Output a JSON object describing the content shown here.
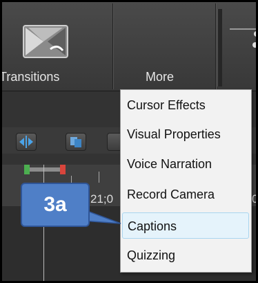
{
  "toolbar": {
    "transitions_label": "Transitions",
    "more_label": "More"
  },
  "timeline": {
    "time_text": "21;0",
    "time_text_right": "0"
  },
  "menu": {
    "items": [
      {
        "label": "Cursor Effects"
      },
      {
        "label": "Visual Properties"
      },
      {
        "label": "Voice Narration"
      },
      {
        "label": "Record Camera"
      },
      {
        "label": "Captions",
        "highlighted": true
      },
      {
        "label": "Quizzing"
      }
    ]
  },
  "callout": {
    "label": "3a",
    "color": "#4f7fc7"
  },
  "icons": [
    "transitions-icon",
    "more-icon",
    "split-icon",
    "copy-icon"
  ]
}
